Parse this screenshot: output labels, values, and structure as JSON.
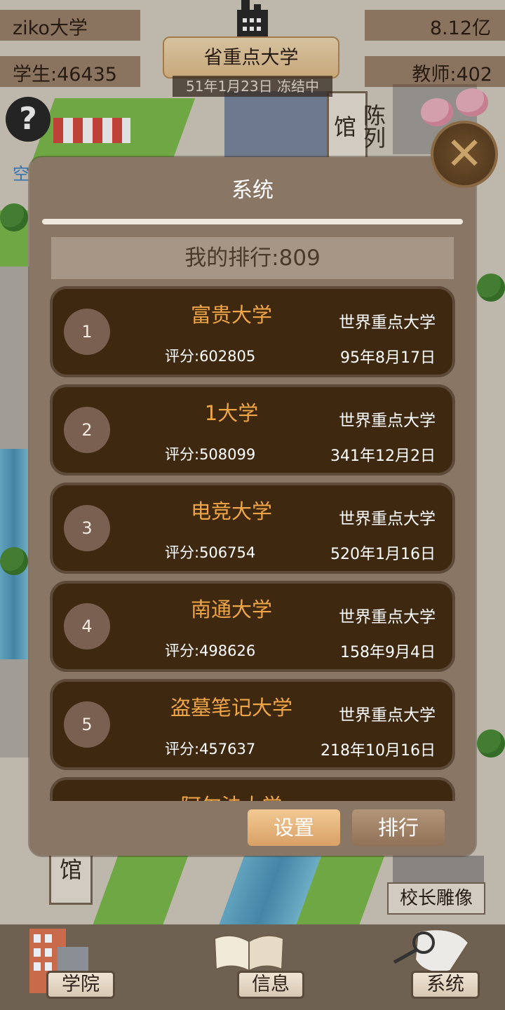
{
  "hud": {
    "university_name": "ziko大学",
    "money": "8.12亿",
    "students": "学生:46435",
    "teachers": "教师:402",
    "rank_title": "省重点大学",
    "date_status": "51年1月23日 冻结中"
  },
  "map_labels": {
    "exhibition_hall": "陈列馆",
    "kong": "空",
    "guan": "馆",
    "statue": "校长雕像"
  },
  "dialog": {
    "title": "系统",
    "my_rank": "我的排行:809",
    "settings_button": "设置",
    "ranking_button": "排行"
  },
  "ranking": [
    {
      "rank": "1",
      "name": "富贵大学",
      "level": "世界重点大学",
      "score": "评分:602805",
      "date": "95年8月17日"
    },
    {
      "rank": "2",
      "name": "1大学",
      "level": "世界重点大学",
      "score": "评分:508099",
      "date": "341年12月2日"
    },
    {
      "rank": "3",
      "name": "电竞大学",
      "level": "世界重点大学",
      "score": "评分:506754",
      "date": "520年1月16日"
    },
    {
      "rank": "4",
      "name": "南通大学",
      "level": "世界重点大学",
      "score": "评分:498626",
      "date": "158年9月4日"
    },
    {
      "rank": "5",
      "name": "盗墓笔记大学",
      "level": "世界重点大学",
      "score": "评分:457637",
      "date": "218年10月16日"
    },
    {
      "rank": "",
      "name": "阿尔法大学",
      "level": "",
      "score": "",
      "date": ""
    }
  ],
  "nav": {
    "college": "学院",
    "info": "信息",
    "system": "系统"
  },
  "colors": {
    "dialog_bg": "#8a7664",
    "row_bg": "#3f2810",
    "name_orange": "#f0a646",
    "settings_btn": "#e4b47c"
  }
}
